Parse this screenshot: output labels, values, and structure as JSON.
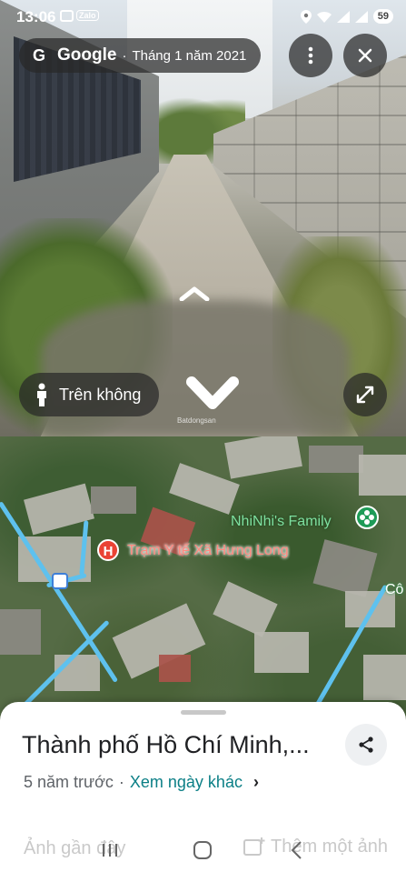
{
  "status_bar": {
    "time": "13:06",
    "zalo_label": "Zalo",
    "battery": "59"
  },
  "street_view": {
    "brand": "Google",
    "separator": "·",
    "capture_date": "Tháng 1 năm 2021",
    "aerial_label": "Trên không",
    "watermark": "Batdongsan"
  },
  "map": {
    "poi_clinic": "Trạm Y tế Xã Hưng Long",
    "poi_clinic_pin": "H",
    "poi_family": "NhiNhi's Family",
    "road_label_partial": "Cô"
  },
  "sheet": {
    "title": "Thành phố Hồ Chí Minh,...",
    "age": "5 năm trước",
    "separator": "·",
    "other_dates_link": "Xem ngày khác",
    "recent_photos": "Ảnh gần đây",
    "add_photo": "Thêm một ảnh"
  },
  "colors": {
    "map_road": "#5ec1ee",
    "link": "#0b7f86",
    "pin_red": "#ea4335",
    "pin_green": "#1e9b57"
  }
}
